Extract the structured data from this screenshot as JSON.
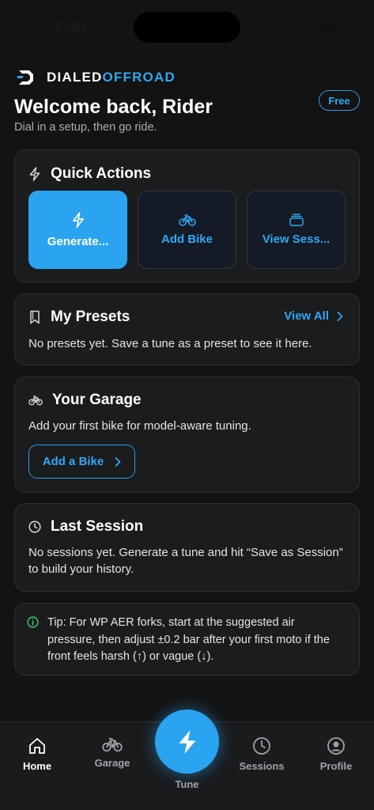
{
  "status_bar": {
    "time": "7:00"
  },
  "brand": {
    "part1": "DIALED",
    "part2": "OFFROAD"
  },
  "header": {
    "welcome": "Welcome back, Rider",
    "subtitle": "Dial in a setup, then go ride.",
    "plan_badge": "Free"
  },
  "quick_actions": {
    "title": "Quick Actions",
    "buttons": [
      {
        "label": "Generate...",
        "icon": "bolt-icon"
      },
      {
        "label": "Add Bike",
        "icon": "bike-icon"
      },
      {
        "label": "View Sess...",
        "icon": "stack-icon"
      }
    ]
  },
  "presets": {
    "title": "My Presets",
    "view_all": "View All",
    "empty_text": "No presets yet. Save a tune as a preset to see it here."
  },
  "garage": {
    "title": "Your Garage",
    "text": "Add your first bike for model-aware tuning.",
    "button": "Add a Bike"
  },
  "last_session": {
    "title": "Last Session",
    "text": "No sessions yet. Generate a tune and hit “Save as Session” to build your history."
  },
  "tip": {
    "text": "Tip: For WP AER forks, start at the suggested air pressure, then adjust ±0.2 bar after your first moto if the front feels harsh (↑) or vague (↓)."
  },
  "tab_bar": {
    "home": "Home",
    "garage": "Garage",
    "tune": "Tune",
    "sessions": "Sessions",
    "profile": "Profile"
  },
  "colors": {
    "accent": "#2aa3f0",
    "background": "#131313",
    "card": "#1b1c1e",
    "tip_green": "#3ecf6a"
  }
}
